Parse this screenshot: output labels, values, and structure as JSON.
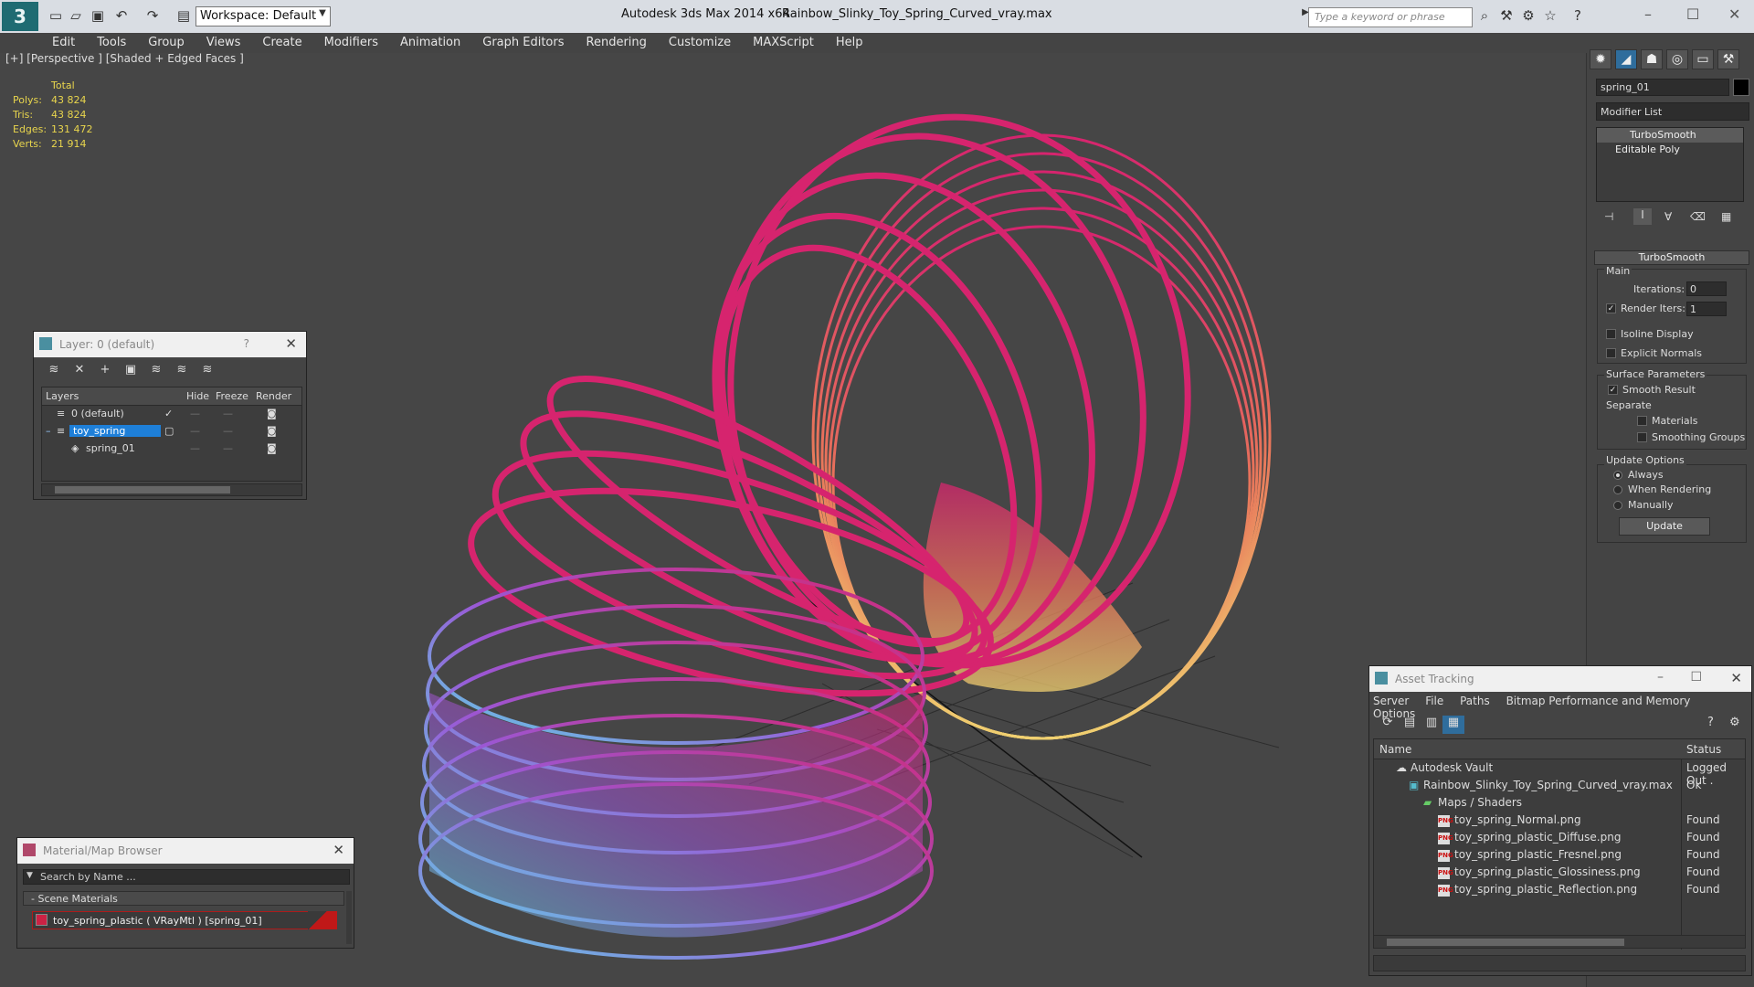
{
  "app": {
    "title": "Autodesk 3ds Max  2014 x64",
    "file": "Rainbow_Slinky_Toy_Spring_Curved_vray.max",
    "logo": "3",
    "workspace": "Workspace: Default",
    "search_placeholder": "Type a keyword or phrase"
  },
  "menu": [
    "Edit",
    "Tools",
    "Group",
    "Views",
    "Create",
    "Modifiers",
    "Animation",
    "Graph Editors",
    "Rendering",
    "Customize",
    "MAXScript",
    "Help"
  ],
  "viewport": {
    "label": "[+] [Perspective ] [Shaded + Edged Faces ]",
    "stats_header": "Total",
    "stats": [
      {
        "label": "Polys:",
        "value": "43 824"
      },
      {
        "label": "Tris:",
        "value": "43 824"
      },
      {
        "label": "Edges:",
        "value": "131 472"
      },
      {
        "label": "Verts:",
        "value": "21 914"
      }
    ]
  },
  "command_panel": {
    "object_name": "spring_01",
    "modifier_list": "Modifier List",
    "stack": [
      "TurboSmooth",
      "Editable Poly"
    ],
    "rollout_title": "TurboSmooth",
    "main_group": "Main",
    "iterations_label": "Iterations:",
    "iterations_value": "0",
    "render_iters_label": "Render Iters:",
    "render_iters_value": "1",
    "isoline": "Isoline Display",
    "explicit_normals": "Explicit Normals",
    "surface_params": "Surface Parameters",
    "smooth_result": "Smooth Result",
    "separate": "Separate",
    "materials": "Materials",
    "smoothing_groups": "Smoothing Groups",
    "update_options": "Update Options",
    "always": "Always",
    "when_rendering": "When Rendering",
    "manually": "Manually",
    "update_button": "Update"
  },
  "layer_dialog": {
    "title": "Layer: 0 (default)",
    "columns": [
      "Layers",
      "Hide",
      "Freeze",
      "Render"
    ],
    "rows": [
      {
        "name": "0 (default)"
      },
      {
        "name": "toy_spring"
      },
      {
        "name": "spring_01"
      }
    ]
  },
  "material_browser": {
    "title": "Material/Map Browser",
    "search_placeholder": "Search by Name ...",
    "group": "- Scene Materials",
    "item": "toy_spring_plastic ( VRayMtl ) [spring_01]"
  },
  "asset_tracking": {
    "title": "Asset Tracking",
    "menu": [
      "Server",
      "File",
      "Paths",
      "Bitmap Performance and Memory",
      "Options"
    ],
    "columns": [
      "Name",
      "Status"
    ],
    "rows": [
      {
        "name": "Autodesk Vault",
        "status": "Logged Out ."
      },
      {
        "name": "Rainbow_Slinky_Toy_Spring_Curved_vray.max",
        "status": "Ok"
      },
      {
        "name": "Maps / Shaders",
        "status": ""
      },
      {
        "name": "toy_spring_Normal.png",
        "status": "Found"
      },
      {
        "name": "toy_spring_plastic_Diffuse.png",
        "status": "Found"
      },
      {
        "name": "toy_spring_plastic_Fresnel.png",
        "status": "Found"
      },
      {
        "name": "toy_spring_plastic_Glossiness.png",
        "status": "Found"
      },
      {
        "name": "toy_spring_plastic_Reflection.png",
        "status": "Found"
      }
    ]
  },
  "colors": {
    "viewport_bg": "#464646",
    "stats_text": "#e8d54d",
    "selection": "#1e7fd8",
    "spring_pink": "#d6246e",
    "spring_purple": "#9a58d6",
    "spring_cyan": "#5fd6e6",
    "spring_yellow": "#f0d070",
    "spring_orange": "#e8745a"
  }
}
